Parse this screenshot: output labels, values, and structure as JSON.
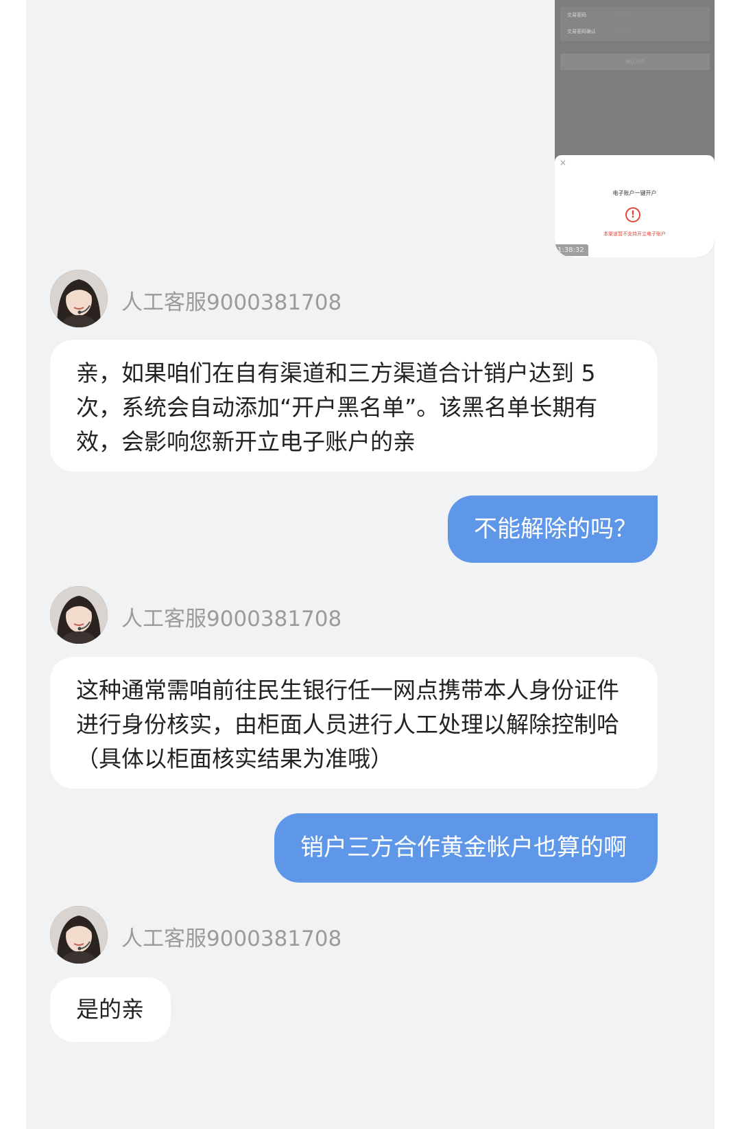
{
  "shared_image": {
    "form_rows": [
      {
        "label": "交易密码",
        "value": "······"
      },
      {
        "label": "交易密码确认",
        "value": "······"
      }
    ],
    "confirm_label": "确认开户",
    "close_icon": "close-icon",
    "sheet_title": "电子账户一键开户",
    "warning_icon": "exclamation-circle-icon",
    "warning_text": "本渠道暂不支持开立电子账户",
    "timestamp": "1:38:32"
  },
  "messages": [
    {
      "sender": "agent",
      "name": "人工客服9000381708",
      "text": "亲，如果咱们在自有渠道和三方渠道合计销户达到 5 次，系统会自动添加“开户黑名单”。该黑名单长期有效，会影响您新开立电子账户的亲"
    },
    {
      "sender": "user",
      "text": "不能解除的吗？"
    },
    {
      "sender": "agent",
      "name": "人工客服9000381708",
      "text": "这种通常需咱前往民生银行任一网点携带本人身份证件进行身份核实，由柜面人员进行人工处理以解除控制哈（具体以柜面核实结果为准哦）"
    },
    {
      "sender": "user",
      "text": "销户三方合作黄金帐户也算的啊"
    },
    {
      "sender": "agent",
      "name": "人工客服9000381708",
      "text": "是的亲"
    }
  ],
  "colors": {
    "user_bubble": "#5f97e8",
    "agent_bubble": "#ffffff",
    "chat_background": "#f1f2f4",
    "warning": "#e0453a"
  }
}
